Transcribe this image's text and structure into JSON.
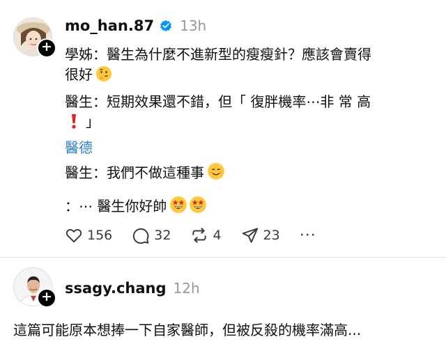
{
  "post": {
    "username": "mo_han.87",
    "time": "13h",
    "verified_icon": "verified-badge-icon",
    "lines": [
      "學姊：醫生為什麼不進新型的瘦瘦針？應該會賣得",
      "很好",
      "醫生：短期效果還不錯，但「 復胖機率⋯非 常 高",
      "」",
      "醫德",
      "醫生：我們不做這種事",
      "：⋯ 醫生你好帥"
    ],
    "emojis": [
      "thinking-face",
      "exclamation-mark",
      "smiling-face",
      "star-struck"
    ],
    "actions": {
      "likes": "156",
      "comments": "32",
      "reposts": "4",
      "shares": "23",
      "more": "···"
    }
  },
  "reply": {
    "username": "ssagy.chang",
    "time": "12h",
    "text": "這篇可能原本想捧一下自家醫師，但被反殺的機率滿高..."
  },
  "colors": {
    "link": "#2f7fd1",
    "verified": "#0095f6",
    "muted": "#999999",
    "text": "#101010"
  }
}
